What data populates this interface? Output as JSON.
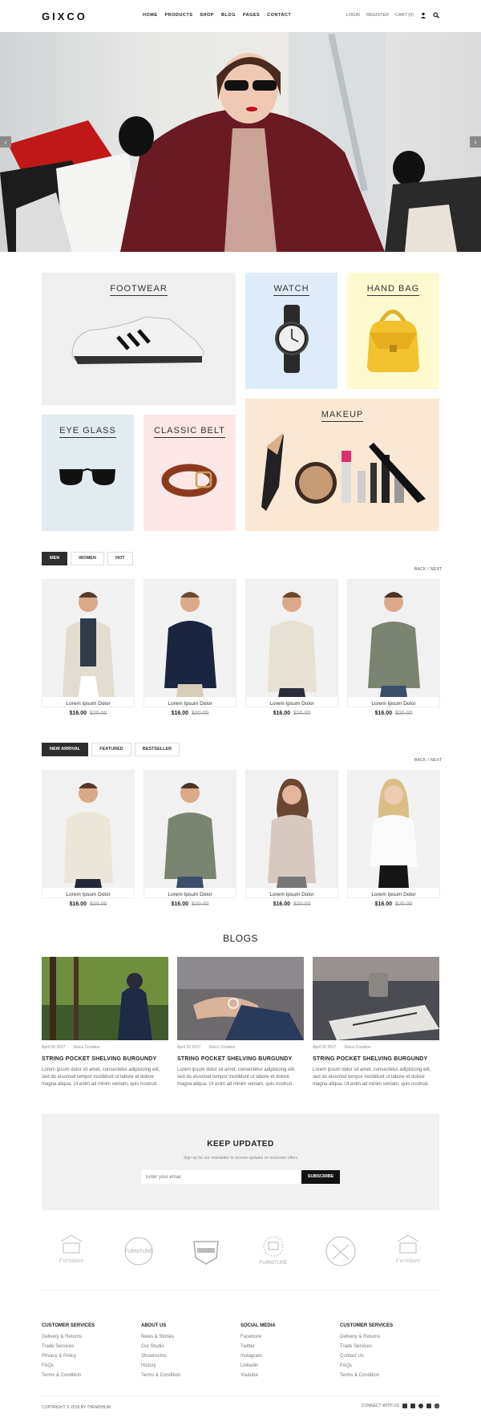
{
  "header": {
    "logo": "GIXCO",
    "nav": [
      "HOME",
      "PRODUCTS",
      "SHOP",
      "BLOG",
      "PAGES",
      "CONTACT"
    ],
    "login": "LOGIN",
    "register": "REGISTER",
    "cart": "CART (0)"
  },
  "hero": {
    "prev_icon": "chevron-left-icon",
    "next_icon": "chevron-right-icon"
  },
  "categories": [
    {
      "title": "FOOTWEAR"
    },
    {
      "title": "WATCH"
    },
    {
      "title": "HAND BAG"
    },
    {
      "title": "EYE GLASS"
    },
    {
      "title": "CLASSIC BELT"
    },
    {
      "title": "MAKEUP"
    }
  ],
  "section1": {
    "tabs": [
      "MEN",
      "WOMEN",
      "HOT"
    ],
    "back": "BACK",
    "next": "NEXT",
    "sep": "/",
    "products": [
      {
        "name": "Lorem Ipsum Dolor",
        "price": "$16.00",
        "old": "$20.00"
      },
      {
        "name": "Lorem Ipsum Dolor",
        "price": "$16.00",
        "old": "$20.00"
      },
      {
        "name": "Lorem Ipsum Dolor",
        "price": "$16.00",
        "old": "$20.00"
      },
      {
        "name": "Lorem Ipsum Dolor",
        "price": "$16.00",
        "old": "$20.00"
      }
    ]
  },
  "section2": {
    "tabs": [
      "NEW ARRIVAL",
      "FEATURED",
      "BESTSELLER"
    ],
    "back": "BACK",
    "next": "NEXT",
    "sep": "/",
    "products": [
      {
        "name": "Lorem Ipsum Dolor",
        "price": "$16.00",
        "old": "$20.00"
      },
      {
        "name": "Lorem Ipsum Dolor",
        "price": "$16.00",
        "old": "$20.00"
      },
      {
        "name": "Lorem Ipsum Dolor",
        "price": "$16.00",
        "old": "$20.00"
      },
      {
        "name": "Lorem Ipsum Dolor",
        "price": "$16.00",
        "old": "$20.00"
      }
    ]
  },
  "blogs": {
    "title": "BLOGS",
    "items": [
      {
        "date": "April 20 2017",
        "author": "Gixco Creation",
        "title": "STRING POCKET SHELVING BURGUNDY",
        "text": "Lorem ipsum dolor sit amet, consectetur adipisicing elit, sed do eiusmod tempor incididunt ut labore et dolore magna aliqua. Ut enim ad minim veniam, quis nostrud."
      },
      {
        "date": "April 20 2017",
        "author": "Gixco Creation",
        "title": "STRING POCKET SHELVING BURGUNDY",
        "text": "Lorem ipsum dolor sit amet, consectetur adipisicing elit, sed do eiusmod tempor incididunt ut labore et dolore magna aliqua. Ut enim ad minim veniam, quis nostrud."
      },
      {
        "date": "April 20 2017",
        "author": "Gixco Creation",
        "title": "STRING POCKET SHELVING BURGUNDY",
        "text": "Lorem ipsum dolor sit amet, consectetur adipisicing elit, sed do eiusmod tempor incididunt ut labore et dolore magna aliqua. Ut enim ad minim veniam, quis nostrud."
      }
    ]
  },
  "newsletter": {
    "title": "KEEP UPDATED",
    "subtitle": "Sign up for our newsletter to receive updates on exclusive offers",
    "placeholder": "Enter your email",
    "button": "SUBSCRIBE"
  },
  "brands": [
    "Furniture",
    "FURNITURE",
    "",
    "FURNITURE",
    "",
    "Furniture"
  ],
  "footer": {
    "columns": [
      {
        "heading": "CUSTOMER SERVICES",
        "links": [
          "Delivery & Returns",
          "Trade Services",
          "Privacy & Policy",
          "FAQs",
          "Terms & Condition"
        ]
      },
      {
        "heading": "ABOUT US",
        "links": [
          "News & Stories",
          "Our Studio",
          "Showrooms",
          "History",
          "Terms & Condition"
        ]
      },
      {
        "heading": "SOCIAL MEDIA",
        "links": [
          "Facebook",
          "Twitter",
          "Instagram",
          "Linkedin",
          "Youtube"
        ]
      },
      {
        "heading": "CUSTOMER SERVICES",
        "links": [
          "Delivery & Returns",
          "Trade Services",
          "Contact Us",
          "FAQs",
          "Terms & Condition"
        ]
      }
    ],
    "copyright": "COPYRIGHT © 2018 BY THEMOHUM",
    "connect": "CONNECT WITH US"
  },
  "colors": {
    "accent": "#111111",
    "footwear_bg": "#efefef",
    "watch_bg": "#deecf9",
    "bag_bg": "#fdfad0",
    "eyeglass_bg": "#e2ebef",
    "belt_bg": "#fde6e6",
    "makeup_bg": "#fbe8d4"
  }
}
